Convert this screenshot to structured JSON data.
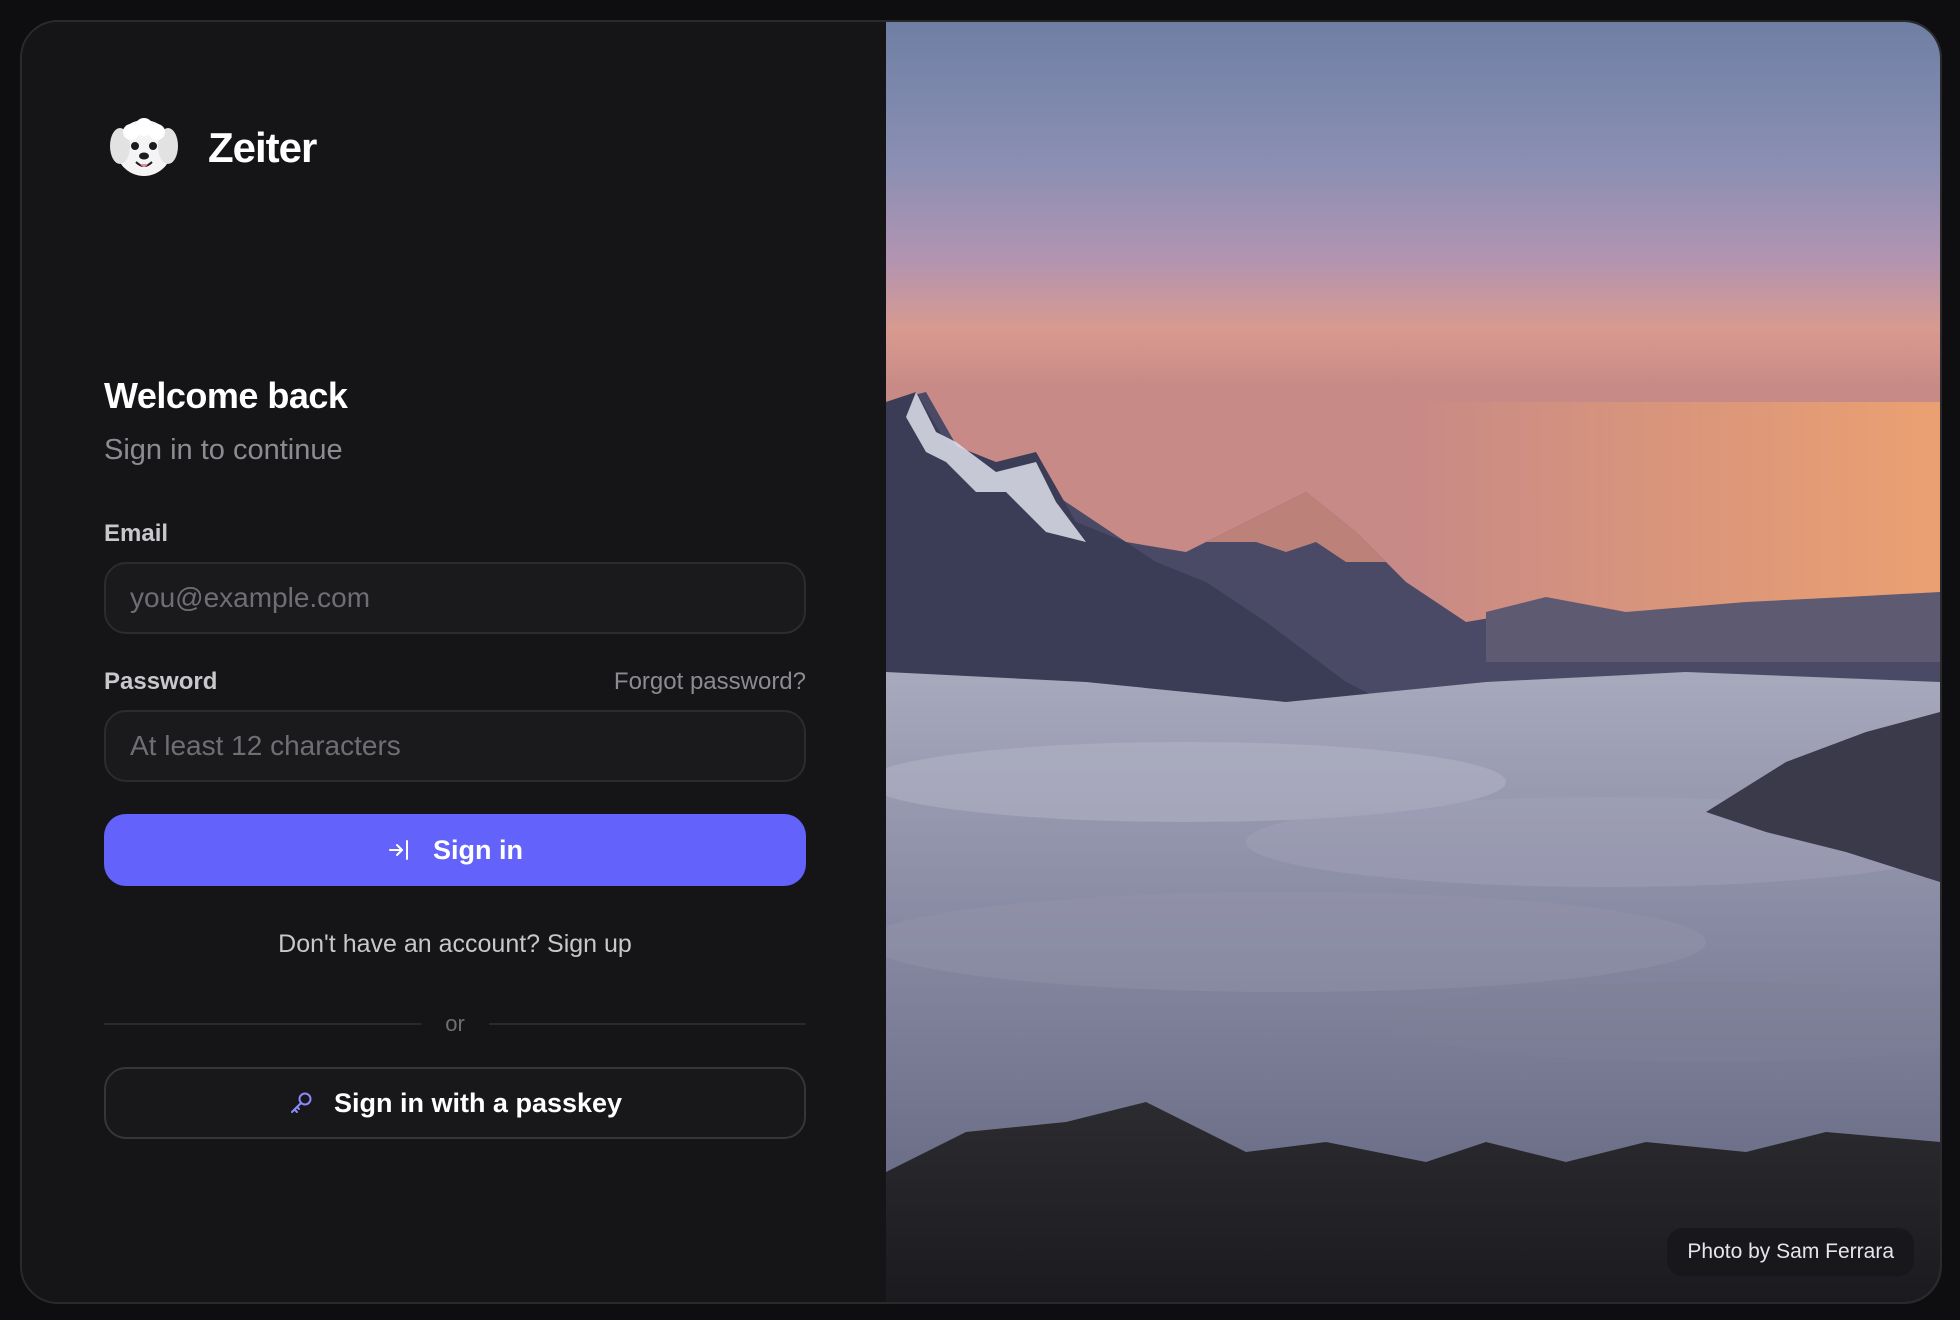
{
  "app": {
    "name": "Zeiter",
    "logo_icon": "dog-face-logo"
  },
  "login": {
    "title": "Welcome back",
    "subtitle": "Sign in to continue",
    "email": {
      "label": "Email",
      "placeholder": "you@example.com",
      "value": ""
    },
    "password": {
      "label": "Password",
      "placeholder": "At least 12 characters",
      "value": "",
      "forgot_link": "Forgot password?"
    },
    "signin_button": {
      "label": "Sign in",
      "icon": "login-arrow-icon"
    },
    "signup_prompt": "Don't have an account? Sign up",
    "divider_text": "or",
    "passkey_button": {
      "label": "Sign in with a passkey",
      "icon": "key-icon"
    }
  },
  "hero": {
    "credit": "Photo by Sam Ferrara"
  },
  "colors": {
    "accent": "#6363fb",
    "background": "#151517",
    "key_icon": "#8a8aff"
  }
}
